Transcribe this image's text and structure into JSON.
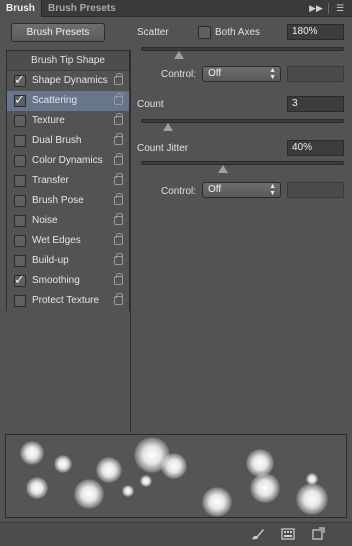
{
  "tabs": {
    "active": "Brush",
    "inactive": "Brush Presets",
    "collapse_glyph": "▶▶",
    "menu_glyph": "☰"
  },
  "left": {
    "presets_button": "Brush Presets",
    "tip_shape": "Brush Tip Shape",
    "options": [
      {
        "label": "Shape Dynamics",
        "checked": true,
        "selected": false
      },
      {
        "label": "Scattering",
        "checked": true,
        "selected": true
      },
      {
        "label": "Texture",
        "checked": false,
        "selected": false
      },
      {
        "label": "Dual Brush",
        "checked": false,
        "selected": false
      },
      {
        "label": "Color Dynamics",
        "checked": false,
        "selected": false
      },
      {
        "label": "Transfer",
        "checked": false,
        "selected": false
      },
      {
        "label": "Brush Pose",
        "checked": false,
        "selected": false
      },
      {
        "label": "Noise",
        "checked": false,
        "selected": false
      },
      {
        "label": "Wet Edges",
        "checked": false,
        "selected": false
      },
      {
        "label": "Build-up",
        "checked": false,
        "selected": false
      },
      {
        "label": "Smoothing",
        "checked": true,
        "selected": false
      },
      {
        "label": "Protect Texture",
        "checked": false,
        "selected": false
      }
    ]
  },
  "scatter": {
    "label": "Scatter",
    "both_axes": "Both Axes",
    "value": "180%",
    "level": 0.18
  },
  "control1": {
    "label": "Control:",
    "value": "Off"
  },
  "count": {
    "label": "Count",
    "value": "3",
    "level": 0.13
  },
  "count_jitter": {
    "label": "Count Jitter",
    "value": "40%",
    "level": 0.4
  },
  "control2": {
    "label": "Control:",
    "value": "Off"
  },
  "bottom_icons": [
    "brush-tool-icon",
    "grid-panel-icon",
    "new-preset-icon"
  ],
  "colors": {
    "panel": "#535353",
    "selected": "#67768b",
    "field": "#3c3c3c"
  }
}
